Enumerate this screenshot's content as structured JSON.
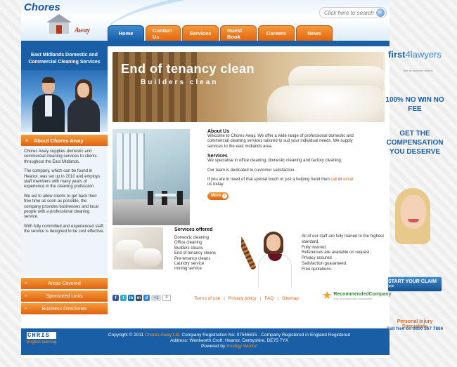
{
  "header": {
    "logo_top": "Chores",
    "logo_bottom": "Away",
    "search_placeholder": "Click here to search"
  },
  "nav": [
    {
      "label": "Home",
      "active": true
    },
    {
      "label": "Contact Us"
    },
    {
      "label": "Services"
    },
    {
      "label": "Guest Book"
    },
    {
      "label": "Careers"
    },
    {
      "label": "News"
    }
  ],
  "sidebar": {
    "title": "East Midlands Domestic and Commercial Cleaning Services",
    "about_title": "About Chores Away",
    "about_p1": "Chores Away supplies domestic and commercial cleaning services to clients throughout the East Midlands.",
    "about_p2": "The company, which can be found in Heanor, was set up in 2010 and employs staff members with many years of experience in the cleaning profession.",
    "about_p3": "We aid to allow clients to get back their free time as soon as possible, the company provides businesses and local people with a professional cleaning service.",
    "about_p4": "With fully committed and experienced staff, the service is designed to be cost effective.",
    "buttons": [
      "Areas Covered",
      "Sponsored Links",
      "Business Directories"
    ]
  },
  "banner": {
    "title": "End of tenancy clean",
    "subtitle": "Builders clean"
  },
  "about_us": {
    "heading": "About Us",
    "text": "Welcome to Chores Away. We offer a wide range of professional domestic and commercial cleaning services tailored to suit your individual needs. We supply services to the east midlands area.",
    "services_heading": "Services",
    "services_text": "We specialise in office cleaning, domestic cleaning and factory cleaning.",
    "team_text": "Our team is dedicated to customer satisfaction.",
    "help_text_1": "If you are in need of that special touch or just a helping hand then",
    "call_link": "call",
    "or_text": "or",
    "email_link": "email",
    "help_text_2": "us today.",
    "more_label": "More"
  },
  "services_offered": {
    "heading": "Services offered",
    "items": [
      "Domestic cleaning",
      "Office cleaning",
      "Builders cleans",
      "End of tenancy cleans",
      "Pre-tenancy cleans",
      "Laundry service",
      "Ironing service"
    ]
  },
  "qualities": [
    "All of our staff are fully trained to the highest standard.",
    "Fully insured.",
    "References are available on request.",
    "Privacy assured.",
    "Satisfaction guaranteed.",
    "Free quotations."
  ],
  "social": {
    "icons": [
      "facebook-icon",
      "twitter-icon",
      "linkedin-icon",
      "myspace-icon",
      "delicious-icon",
      "google-plus-icon"
    ],
    "count": "0"
  },
  "footer_links": [
    "Terms of use",
    "Privacy policy",
    "FAQ",
    "Sitemap"
  ],
  "recommended": {
    "brand": "RecommendedCompany",
    "sub": "only recommended businesses"
  },
  "footer": {
    "logo_text": "CHRIS",
    "logo_tag": "English tailoring",
    "copyright_prefix": "Copyright © 2011",
    "company": "Chores Away Ltd.",
    "copyright_rest": "Company Registration No: 07546615 - Company Registered in England Registered",
    "address": "Address: Wentworth Croft, Heanor, Derbyshire, DE75 7YX",
    "powered_prefix": "Powered by",
    "powered_by": "Prodigy Works!"
  },
  "ad": {
    "brand_a": "first",
    "brand_b": "4lawyers",
    "brand_sub": "first for accident victims",
    "line1": "100% NO WIN NO FEE",
    "line2": "GET THE COMPENSATION YOU DESERVE",
    "claim": "START YOUR CLAIM >>",
    "pi": "Personal Injury Specialists",
    "call": "Call free on 0800 567 7866"
  },
  "colors": {
    "brand_blue": "#1a5ea6",
    "accent_orange": "#e0620f"
  }
}
